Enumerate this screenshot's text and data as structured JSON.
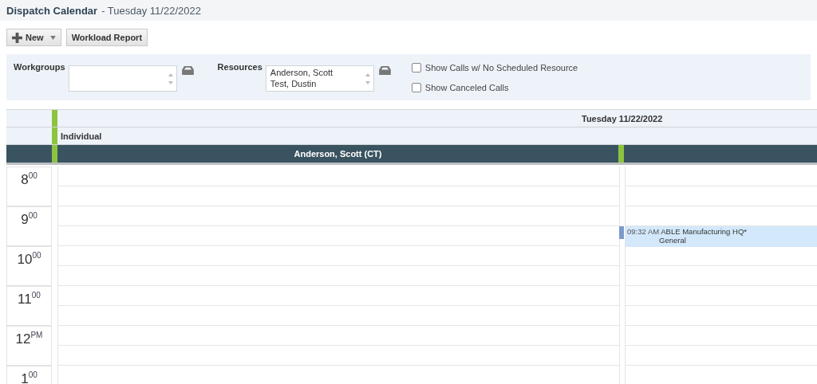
{
  "title": {
    "main": "Dispatch Calendar",
    "sub": "- Tuesday 11/22/2022"
  },
  "toolbar": [
    {
      "kind": "menu",
      "label": "New"
    },
    {
      "kind": "plain",
      "label": "Workload Report"
    }
  ],
  "filters": {
    "workgroups": {
      "label": "Workgroups"
    },
    "resources": {
      "label": "Resources",
      "items": [
        "Anderson, Scott",
        "Test, Dustin"
      ]
    },
    "options": [
      {
        "label": "Show Calls w/ No Scheduled Resource",
        "checked": false
      },
      {
        "label": "Show Canceled Calls",
        "checked": false
      }
    ]
  },
  "calendar": {
    "date_header": "Tuesday 11/22/2022",
    "group": "Individual",
    "resource": "Anderson, Scott (CT)",
    "hours": [
      {
        "hour": "8",
        "suffix": "00"
      },
      {
        "hour": "9",
        "suffix": "00",
        "events_at_half_hour": [
          {
            "time": "09:32 AM",
            "title": "ABLE Manufacturing HQ*",
            "subtitle": "General"
          }
        ]
      },
      {
        "hour": "10",
        "suffix": "00"
      },
      {
        "hour": "11",
        "suffix": "00"
      },
      {
        "hour": "12",
        "suffix": "PM"
      },
      {
        "hour": "1",
        "suffix": "00"
      }
    ]
  }
}
